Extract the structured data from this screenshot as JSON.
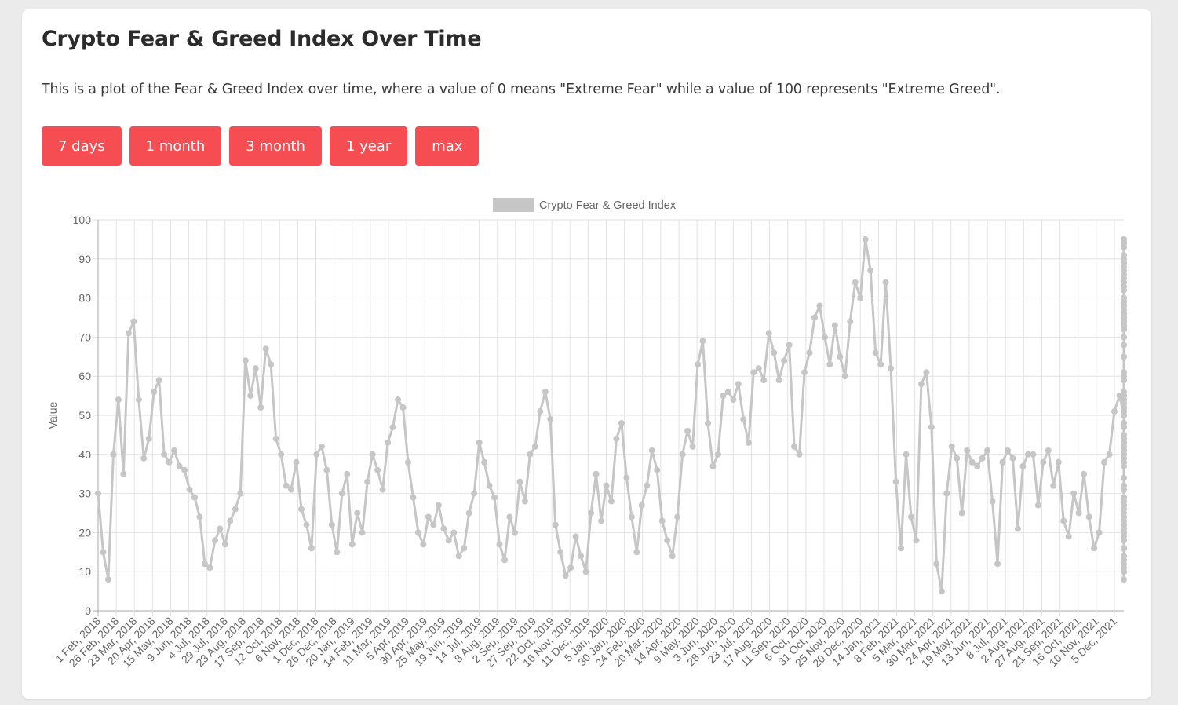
{
  "page": {
    "title": "Crypto Fear & Greed Index Over Time",
    "description": "This is a plot of the Fear & Greed Index over time, where a value of 0 means \"Extreme Fear\" while a value of 100 represents \"Extreme Greed\".",
    "range_buttons": [
      {
        "label": "7 days"
      },
      {
        "label": "1 month"
      },
      {
        "label": "3 month"
      },
      {
        "label": "1 year"
      },
      {
        "label": "max"
      }
    ],
    "accent_color": "#f54d52"
  },
  "chart_data": {
    "type": "line",
    "title": "",
    "xlabel": "",
    "ylabel": "Value",
    "ylim": [
      0,
      100
    ],
    "yticks": [
      0,
      10,
      20,
      30,
      40,
      50,
      60,
      70,
      80,
      90,
      100
    ],
    "grid": true,
    "legend": {
      "position": "top-center",
      "entries": [
        {
          "name": "Crypto Fear & Greed Index",
          "color": "#c6c6c6"
        }
      ]
    },
    "x_tick_labels": [
      "1 Feb, 2018",
      "26 Feb, 2018",
      "23 Mar, 2018",
      "20 Apr, 2018",
      "15 May, 2018",
      "9 Jun, 2018",
      "4 Jul, 2018",
      "29 Jul, 2018",
      "23 Aug, 2018",
      "17 Sep, 2018",
      "12 Oct, 2018",
      "6 Nov, 2018",
      "1 Dec, 2018",
      "26 Dec, 2018",
      "20 Jan, 2019",
      "14 Feb, 2019",
      "11 Mar, 2019",
      "5 Apr, 2019",
      "30 Apr, 2019",
      "25 May, 2019",
      "19 Jun, 2019",
      "14 Jul, 2019",
      "8 Aug, 2019",
      "2 Sep, 2019",
      "27 Sep, 2019",
      "22 Oct, 2019",
      "16 Nov, 2019",
      "11 Dec, 2019",
      "5 Jan, 2020",
      "30 Jan, 2020",
      "24 Feb, 2020",
      "20 Mar, 2020",
      "14 Apr, 2020",
      "9 May, 2020",
      "3 Jun, 2020",
      "28 Jun, 2020",
      "23 Jul, 2020",
      "17 Aug, 2020",
      "11 Sep, 2020",
      "6 Oct, 2020",
      "31 Oct, 2020",
      "25 Nov, 2020",
      "20 Dec, 2020",
      "14 Jan, 2021",
      "8 Feb, 2021",
      "5 Mar, 2021",
      "30 Mar, 2021",
      "24 Apr, 2021",
      "19 May, 2021",
      "13 Jun, 2021",
      "8 Jul, 2021",
      "2 Aug, 2021",
      "27 Aug, 2021",
      "21 Sep, 2021",
      "16 Oct, 2021",
      "10 Nov, 2021",
      "5 Dec, 2021"
    ],
    "x_tick_interval_days": 25,
    "total_days": 1413,
    "series": [
      {
        "name": "Crypto Fear & Greed Index",
        "color": "#c6c6c6",
        "sample_interval_days": 7,
        "values": [
          30,
          15,
          8,
          40,
          54,
          35,
          71,
          74,
          54,
          39,
          44,
          56,
          59,
          40,
          38,
          41,
          37,
          36,
          31,
          29,
          24,
          12,
          11,
          18,
          21,
          17,
          23,
          26,
          30,
          64,
          55,
          62,
          52,
          67,
          63,
          44,
          40,
          32,
          31,
          38,
          26,
          22,
          16,
          40,
          42,
          36,
          22,
          15,
          30,
          35,
          17,
          25,
          20,
          33,
          40,
          36,
          31,
          43,
          47,
          54,
          52,
          38,
          29,
          20,
          17,
          24,
          22,
          27,
          21,
          18,
          20,
          14,
          16,
          25,
          30,
          43,
          38,
          32,
          29,
          17,
          13,
          24,
          20,
          33,
          28,
          40,
          42,
          51,
          56,
          49,
          22,
          15,
          9,
          11,
          19,
          14,
          10,
          25,
          35,
          23,
          32,
          28,
          44,
          48,
          34,
          24,
          15,
          27,
          32,
          41,
          36,
          23,
          18,
          14,
          24,
          40,
          46,
          42,
          63,
          69,
          48,
          37,
          40,
          55,
          56,
          54,
          58,
          49,
          43,
          61,
          62,
          59,
          71,
          66,
          59,
          64,
          68,
          42,
          40,
          61,
          66,
          75,
          78,
          70,
          63,
          73,
          65,
          60,
          74,
          84,
          80,
          95,
          87,
          66,
          63,
          84,
          62,
          33,
          16,
          40,
          24,
          18,
          58,
          61,
          47,
          12,
          5,
          30,
          42,
          39,
          25,
          41,
          38,
          37,
          39,
          41,
          28,
          12,
          38,
          41,
          39,
          21,
          37,
          40,
          40,
          27,
          38,
          41,
          32,
          38,
          23,
          19,
          30,
          25,
          35,
          24,
          16,
          20,
          38,
          40,
          51,
          55,
          50,
          43,
          56,
          61,
          65,
          47,
          43,
          39,
          41,
          16,
          8,
          13,
          12,
          10,
          11,
          14,
          21,
          27,
          41,
          43,
          55,
          40,
          50,
          45,
          51,
          40,
          53,
          38,
          41,
          37,
          44,
          41,
          43,
          40,
          44,
          55,
          76,
          83,
          79,
          76,
          80,
          77,
          74,
          83,
          40,
          39,
          48,
          52,
          42,
          45,
          48,
          55,
          51,
          61,
          73,
          75,
          70,
          84,
          90,
          87,
          89,
          93,
          95,
          91,
          86,
          94,
          95,
          90,
          89,
          94,
          90,
          95,
          94,
          79,
          80,
          75,
          55,
          85,
          93,
          95,
          94,
          88,
          78,
          76,
          82,
          80,
          72,
          75,
          79,
          65,
          54,
          72,
          74,
          79,
          75,
          68,
          73,
          75,
          54,
          52,
          27,
          68,
          72,
          20,
          10,
          22,
          16,
          23,
          25,
          38,
          19,
          10,
          26,
          22,
          21,
          28,
          20,
          24,
          10,
          23,
          32,
          50,
          60,
          72,
          74,
          76,
          78,
          73,
          72,
          79,
          31,
          47,
          52,
          53,
          21,
          29,
          31,
          54,
          59,
          72,
          75,
          78,
          84,
          70,
          73,
          76,
          74,
          84,
          72,
          50,
          34,
          24,
          29,
          21,
          27,
          18,
          16,
          28
        ]
      }
    ]
  }
}
